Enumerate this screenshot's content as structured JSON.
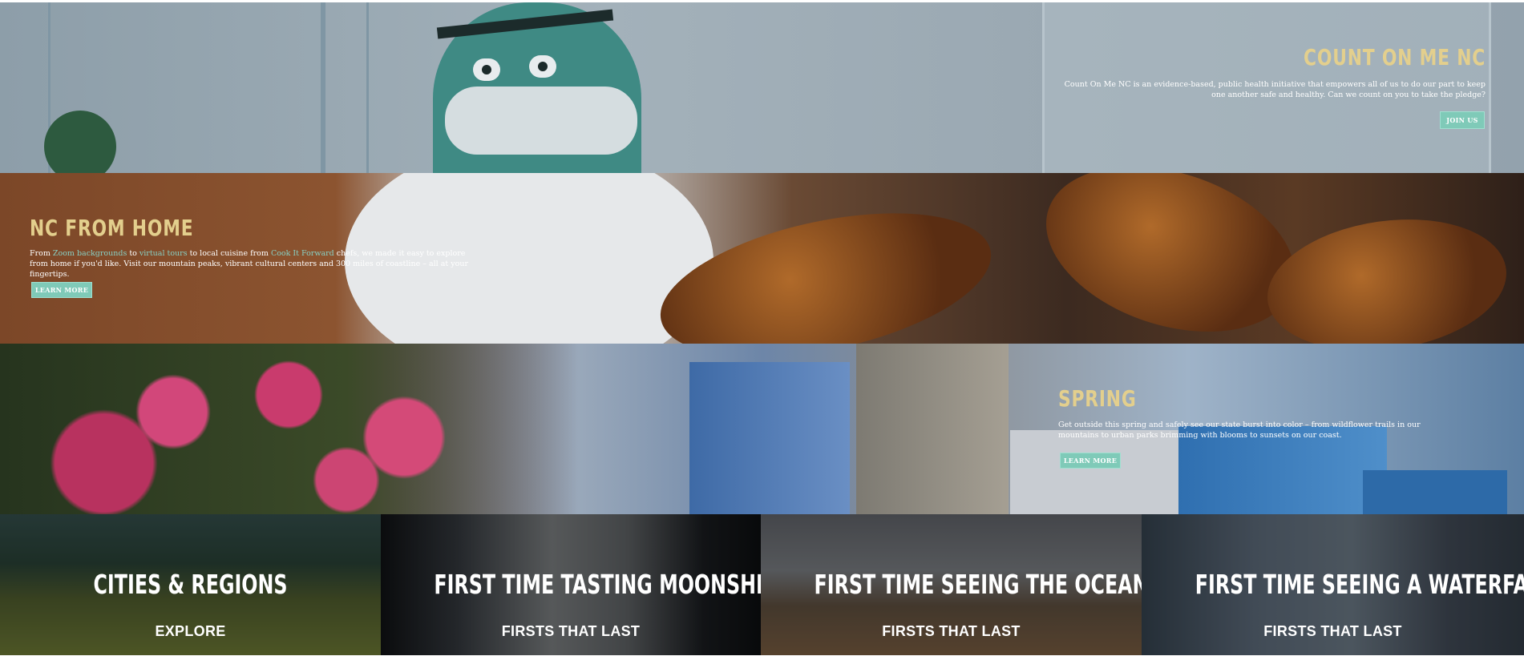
{
  "promos": {
    "count_on_me": {
      "title": "COUNT ON ME NC",
      "description": "Count On Me NC is an evidence-based, public health initiative that empowers all of us to do our part to keep one another safe and healthy. Can we count on you to take the pledge?",
      "button_label": "JOIN US"
    },
    "nc_from_home": {
      "title": "NC FROM HOME",
      "desc_part1": "From ",
      "link1": "Zoom backgrounds",
      "desc_part2": " to ",
      "link2": "virtual tours",
      "desc_part3": " to local cuisine from ",
      "link3": "Cook It Forward",
      "desc_part4": " chefs, we made it easy to explore from home if you'd like. Visit our mountain peaks, vibrant cultural centers and 300 miles of coastline – all at your fingertips.",
      "button_label": "LEARN MORE"
    },
    "spring": {
      "title": "SPRING",
      "description": "Get outside this spring and safely see our state burst into color – from wildflower trails in our mountains to urban parks brimming with blooms to sunsets on our coast.",
      "button_label": "LEARN MORE"
    }
  },
  "tiles": [
    {
      "title": "CITIES & REGIONS",
      "subtitle": "EXPLORE"
    },
    {
      "title": "FIRST TIME TASTING MOONSHINE",
      "subtitle": "FIRSTS THAT LAST"
    },
    {
      "title": "FIRST TIME SEEING THE OCEAN",
      "subtitle": "FIRSTS THAT LAST"
    },
    {
      "title": "FIRST TIME SEEING A WATERFALL",
      "subtitle": "FIRSTS THAT LAST"
    }
  ],
  "colors": {
    "heading_gold": "#e3cf8d",
    "button_teal": "#7fcab8",
    "link_teal": "#88d0c4"
  }
}
